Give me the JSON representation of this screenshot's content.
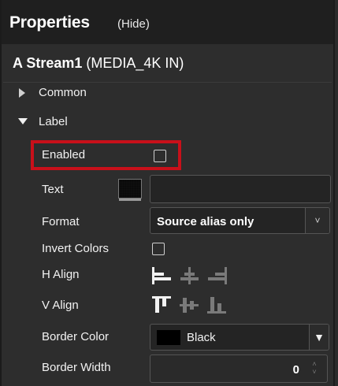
{
  "header": {
    "title": "Properties",
    "hide_label": "(Hide)"
  },
  "stream": {
    "name": "A Stream1",
    "source": "(MEDIA_4K IN)"
  },
  "sections": {
    "common": "Common",
    "label": "Label"
  },
  "props": {
    "enabled": {
      "label": "Enabled",
      "checked": false
    },
    "text": {
      "label": "Text",
      "value": ""
    },
    "format": {
      "label": "Format",
      "value": "Source alias only"
    },
    "invert": {
      "label": "Invert Colors",
      "checked": false
    },
    "h_align": {
      "label": "H Align",
      "options": [
        "left",
        "center",
        "right"
      ],
      "selected": "left"
    },
    "v_align": {
      "label": "V Align",
      "options": [
        "top",
        "middle",
        "bottom"
      ],
      "selected": "top"
    },
    "border_color": {
      "label": "Border Color",
      "value": "Black",
      "swatch": "#000000"
    },
    "border_width": {
      "label": "Border Width",
      "value": "0"
    }
  },
  "colors": {
    "highlight": "#c8101a",
    "panel": "#2d2d2d",
    "header": "#1f1f1f"
  }
}
